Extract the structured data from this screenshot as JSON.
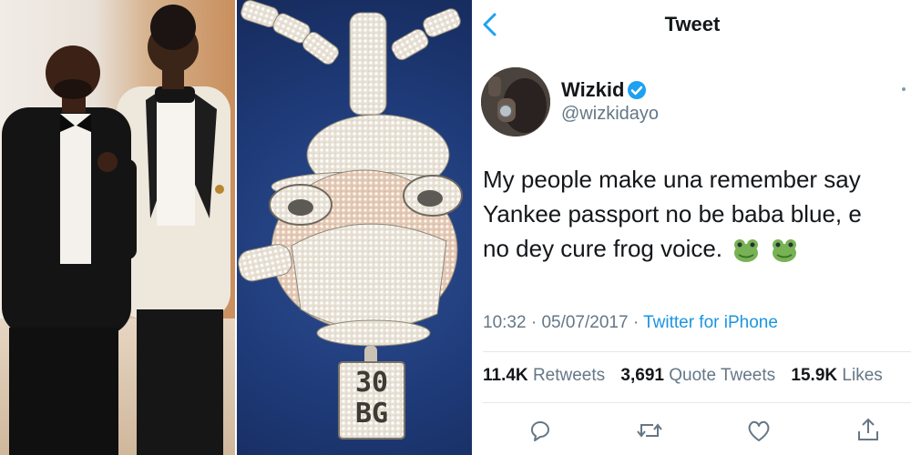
{
  "header": {
    "title": "Tweet",
    "back_icon": "back-chevron-icon"
  },
  "tweet": {
    "author_name": "Wizkid",
    "author_handle": "@wizkidayo",
    "verified_icon": "verified-badge-icon",
    "text_lines": [
      "My people make una remember say",
      "Yankee passport no be baba blue, e",
      "no dey cure frog voice."
    ],
    "emoji": "frog-emoji",
    "time": "10:32",
    "date": "05/07/2017",
    "source": "Twitter for iPhone",
    "stats": {
      "retweets_count": "11.4K",
      "retweets_label": "Retweets",
      "quotes_count": "3,691",
      "quotes_label": "Quote Tweets",
      "likes_count": "15.9K",
      "likes_label": "Likes"
    }
  },
  "photos": {
    "pendant_text_top": "30",
    "pendant_text_bottom": "BG"
  },
  "actions": [
    "reply-icon",
    "retweet-icon",
    "like-icon",
    "share-icon"
  ],
  "colors": {
    "accent": "#1b95e0",
    "verified": "#1da1f2",
    "secondary_text": "#657786",
    "primary_text": "#14171a",
    "pendant_backdrop": "#1e3a78"
  }
}
